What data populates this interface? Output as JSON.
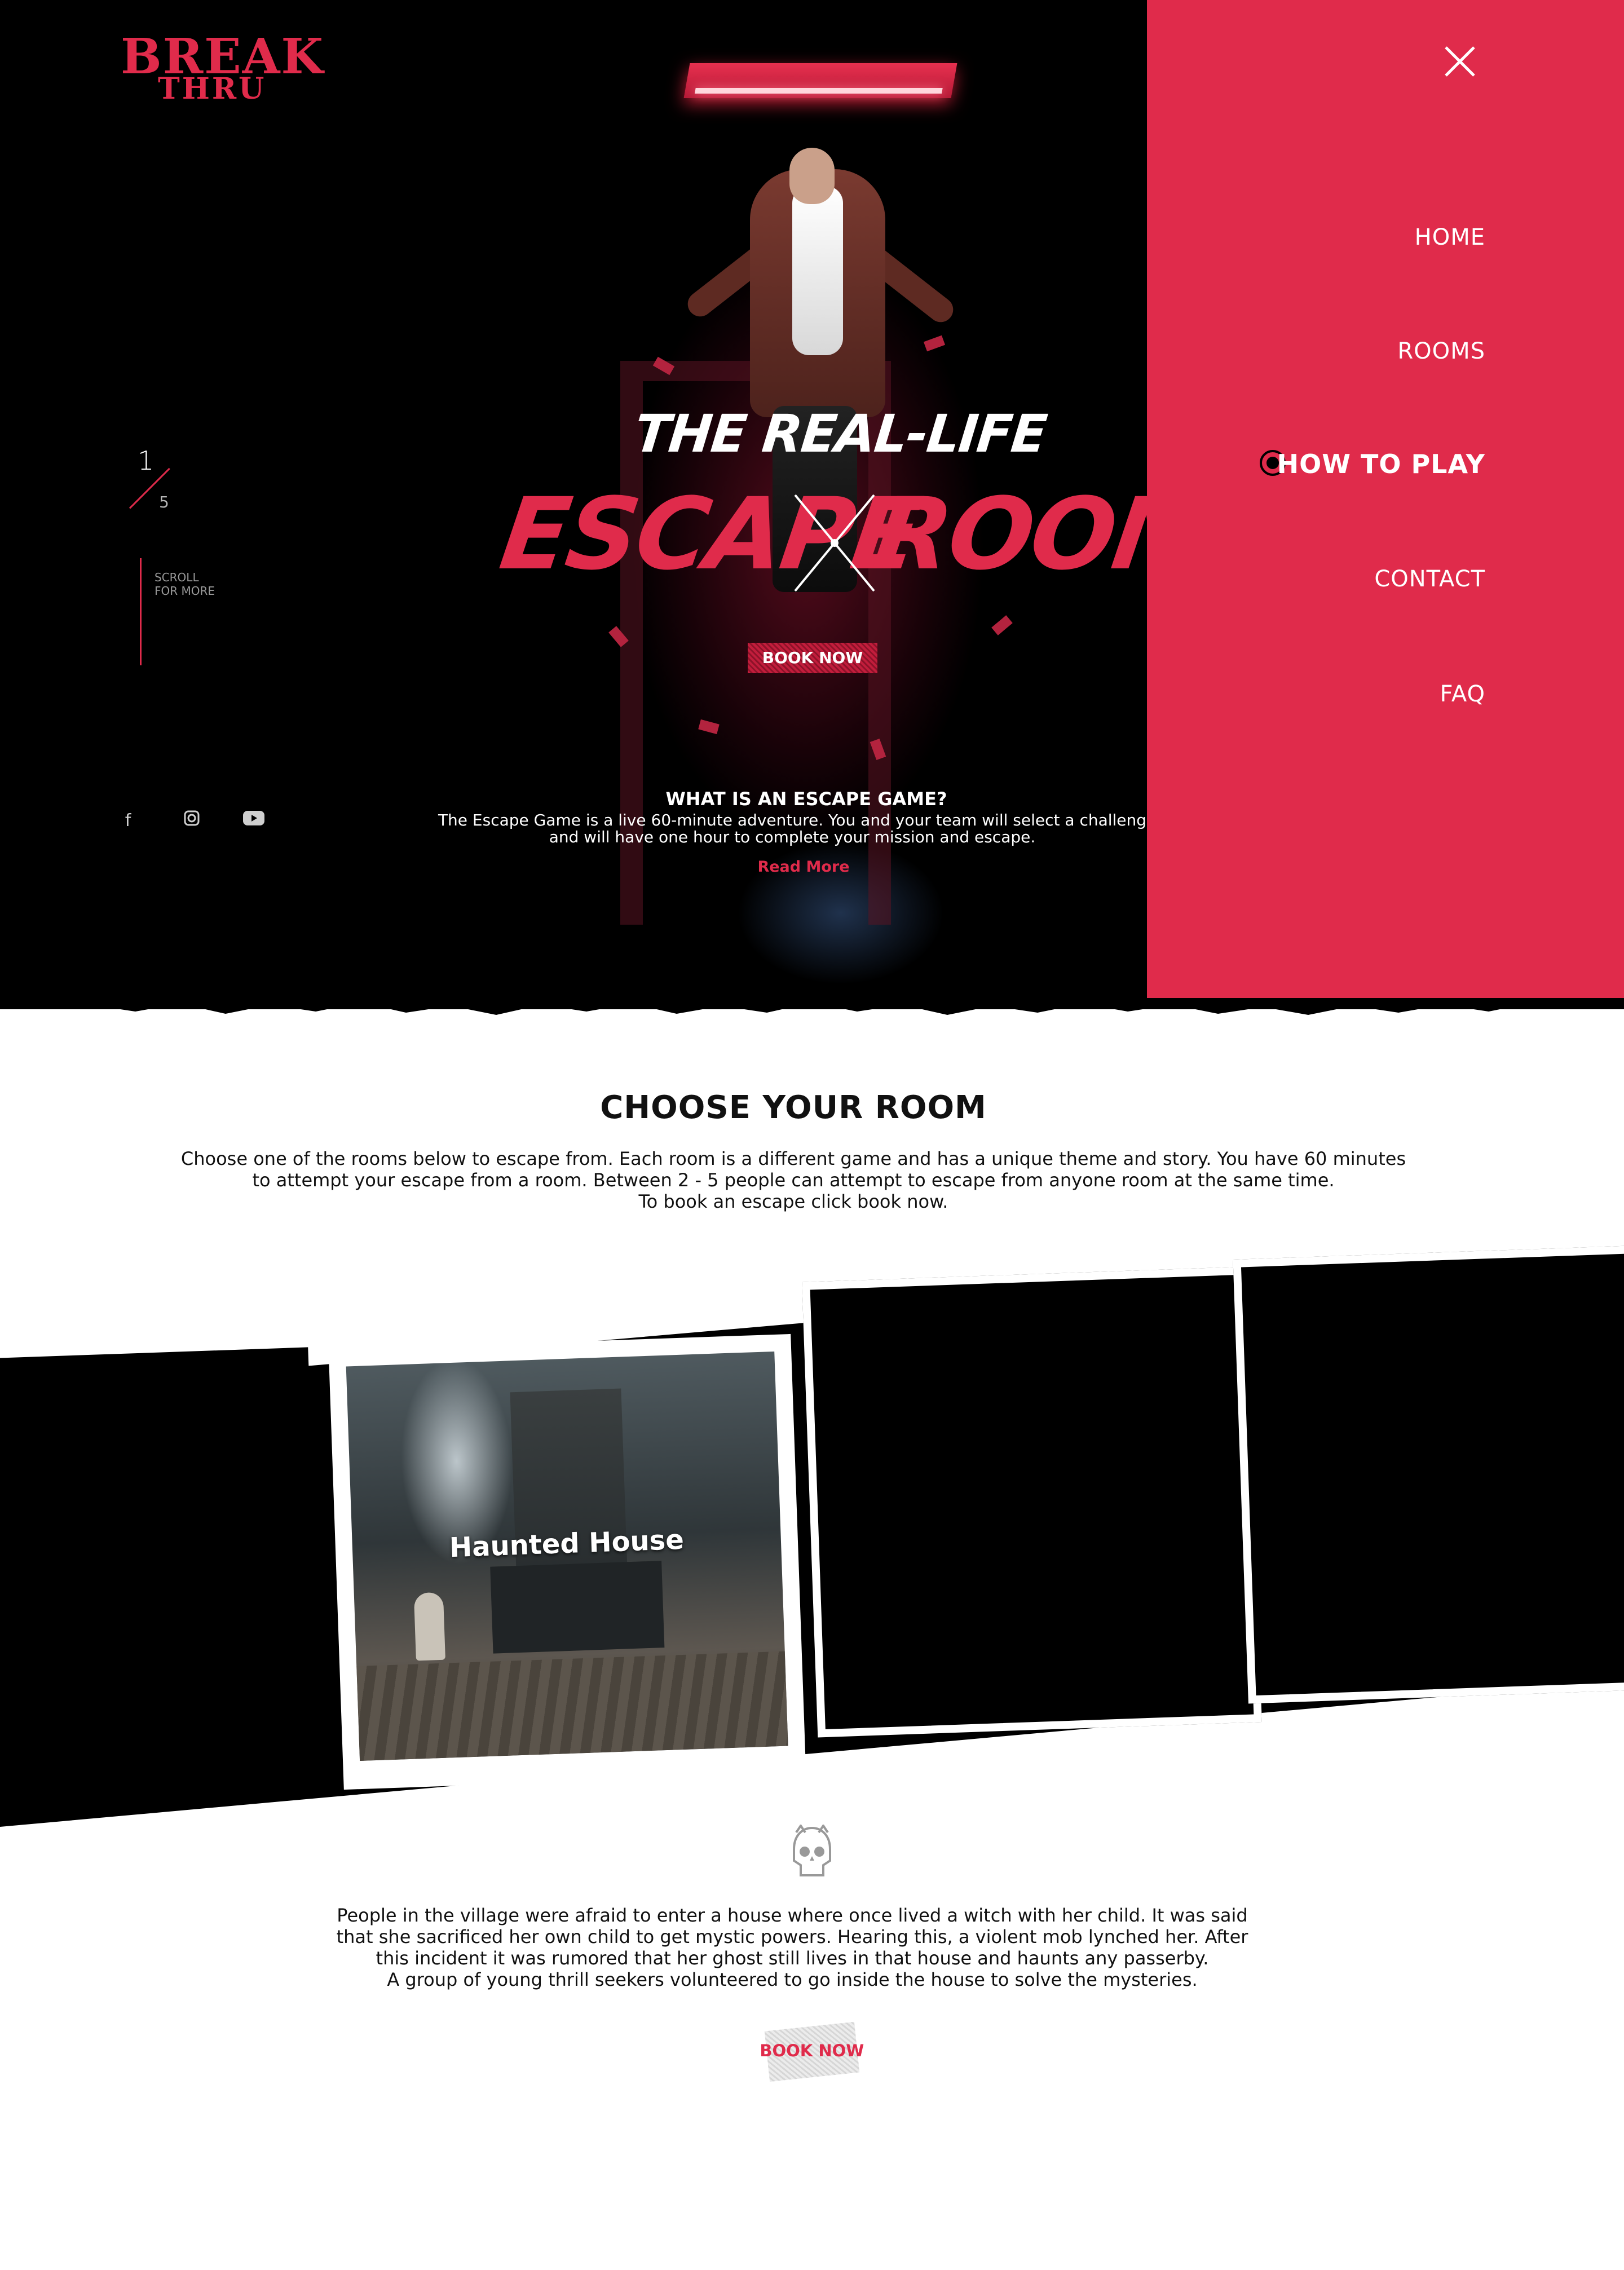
{
  "brand": {
    "line1": "BREAK",
    "line2": "THRU"
  },
  "hero": {
    "tagline": "THE REAL-LIFE",
    "headline_left": "ESCAPE",
    "headline_right": "ROOM",
    "book_label": "BOOK NOW",
    "pager_current": "1",
    "pager_total": "5",
    "scroll_label": "SCROLL FOR MORE",
    "what_title": "WHAT IS AN ESCAPE GAME?",
    "what_line1": "The Escape Game is a live 60-minute adventure. You and your team will select a challeng",
    "what_line2": "and will have one hour to complete your mission and escape.",
    "read_more": "Read More",
    "social": [
      "facebook-icon",
      "instagram-icon",
      "youtube-icon"
    ]
  },
  "menu": {
    "items": [
      {
        "label": "HOME"
      },
      {
        "label": "ROOMS"
      },
      {
        "label": "HOW TO PLAY",
        "active": true
      },
      {
        "label": "CONTACT"
      },
      {
        "label": "FAQ"
      }
    ]
  },
  "rooms": {
    "title": "CHOOSE YOUR ROOM",
    "desc_line1": "Choose one of the rooms below to escape from. Each room is a different game and has a unique theme and story. You have 60 minutes",
    "desc_line2": "to attempt your escape from a room. Between 2 - 5 people can attempt to escape from anyone room at the same time.",
    "desc_line3": "To book an escape click book now.",
    "featured_room": "Haunted House"
  },
  "story": {
    "line1": "People in the village were afraid to enter a house where once lived a witch with her child. It was said",
    "line2": "that she sacrificed her own child to get mystic powers. Hearing this, a violent mob lynched her. After",
    "line3": "this incident it was rumored that her ghost still lives in that house and haunts any passerby.",
    "line4": "A group of young thrill seekers volunteered to go inside the house to solve the mysteries.",
    "book_label": "BOOK NOW"
  },
  "colors": {
    "accent": "#e02b4b",
    "dark": "#000000",
    "light": "#ffffff"
  }
}
